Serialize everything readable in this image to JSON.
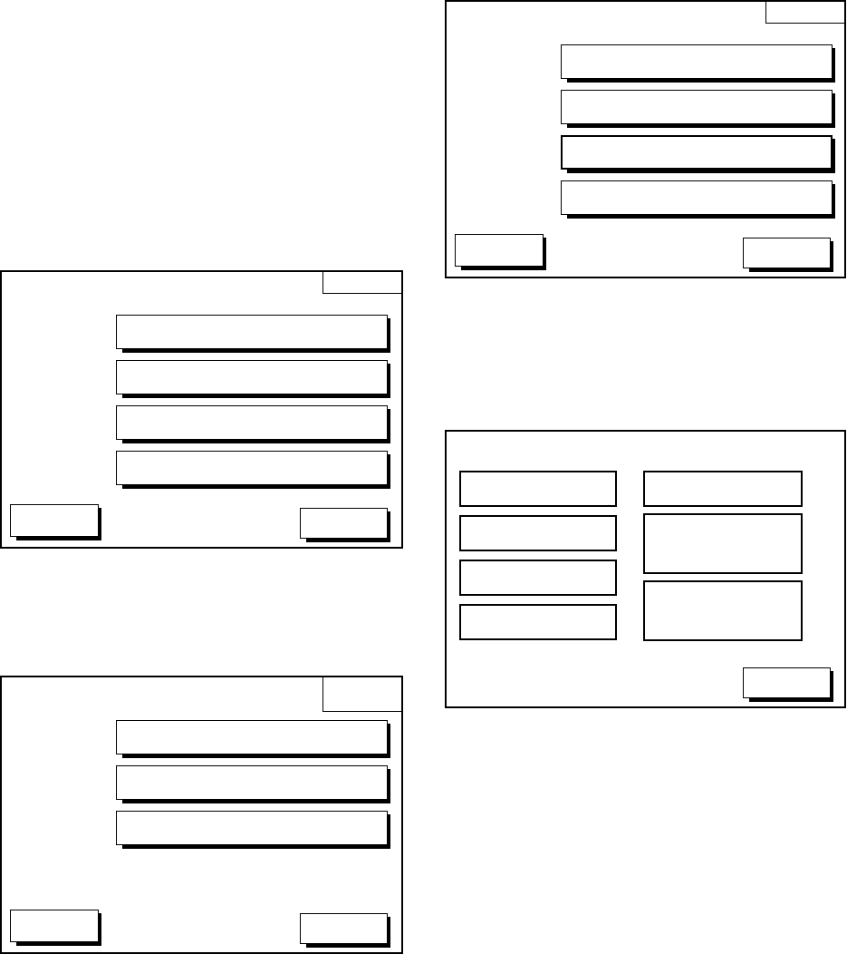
{
  "page_columns": [
    {
      "screens": [
        {
          "kind": "list",
          "tab": {
            "kind": "short"
          },
          "options": [
            {
              "kind": "plain"
            },
            {
              "kind": "plain"
            },
            {
              "kind": "plain"
            },
            {
              "kind": "plain"
            }
          ],
          "footer_buttons": [
            {
              "kind": "left"
            },
            {
              "kind": "right"
            }
          ]
        },
        {
          "kind": "list",
          "tab": {
            "kind": "tall"
          },
          "options": [
            {
              "kind": "plain"
            },
            {
              "kind": "plain"
            },
            {
              "kind": "plain"
            }
          ],
          "footer_buttons": [
            {
              "kind": "left"
            },
            {
              "kind": "right"
            }
          ]
        }
      ]
    },
    {
      "screens": [
        {
          "kind": "list",
          "tab": {
            "kind": "short"
          },
          "options": [
            {
              "kind": "plain"
            },
            {
              "kind": "plain"
            },
            {
              "kind": "bold"
            },
            {
              "kind": "plain"
            }
          ],
          "footer_buttons": [
            {
              "kind": "left"
            },
            {
              "kind": "right"
            }
          ]
        },
        {
          "kind": "grid",
          "columns": [
            {
              "buttons": [
                {
                  "kind": "short"
                },
                {
                  "kind": "short"
                },
                {
                  "kind": "short"
                },
                {
                  "kind": "short"
                }
              ]
            },
            {
              "buttons": [
                {
                  "kind": "short"
                },
                {
                  "kind": "tall"
                },
                {
                  "kind": "tall"
                }
              ]
            }
          ],
          "footer_buttons": [
            {
              "kind": "right"
            }
          ]
        }
      ]
    }
  ]
}
